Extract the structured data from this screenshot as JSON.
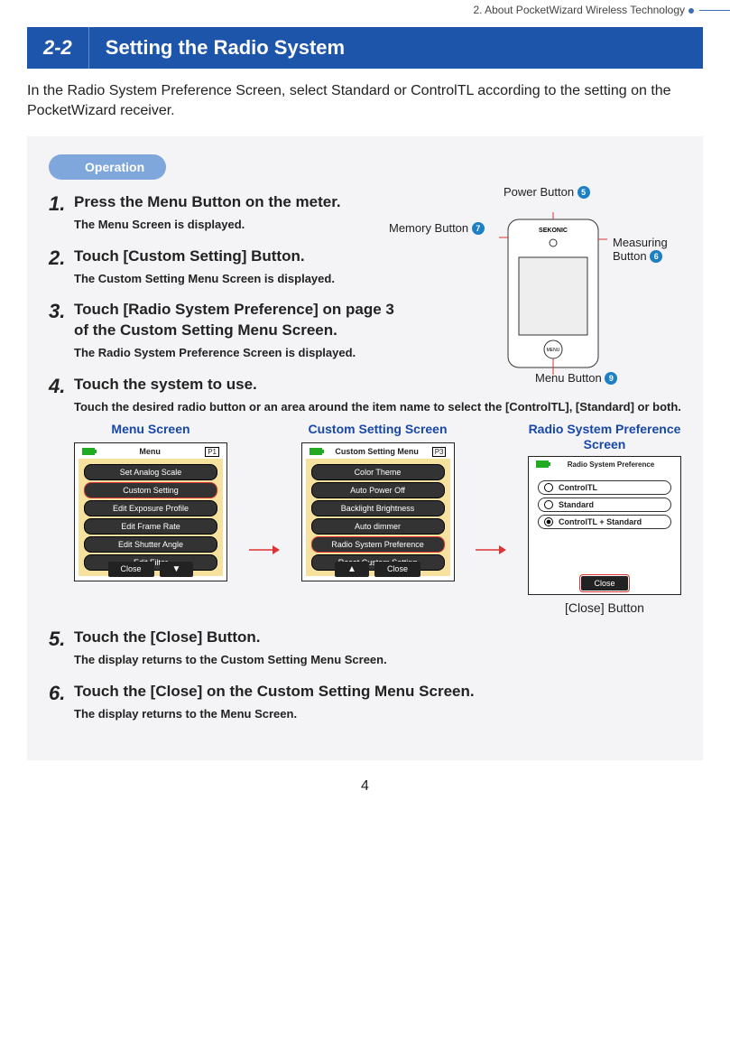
{
  "header_breadcrumb": "2.  About PocketWizard Wireless Technology",
  "section_number": "2-2",
  "section_title": "Setting the Radio System",
  "intro": "In the Radio System Preference Screen, select Standard or ControlTL according to the setting on the PocketWizard receiver.",
  "operation_label": "Operation",
  "diagram": {
    "power_button": "Power Button",
    "power_num": "5",
    "memory_button": "Memory Button",
    "memory_num": "7",
    "measuring_button_l1": "Measuring",
    "measuring_button_l2": "Button",
    "measuring_num": "6",
    "menu_button": "Menu Button",
    "menu_num": "9",
    "brand": "SEKONIC",
    "menu_text": "MENU"
  },
  "steps": [
    {
      "n": "1",
      "title": "Press the Menu Button on the meter.",
      "desc": "The Menu Screen is displayed."
    },
    {
      "n": "2",
      "title": "Touch [Custom Setting] Button.",
      "desc": "The Custom Setting Menu Screen is displayed."
    },
    {
      "n": "3",
      "title": "Touch [Radio System Preference] on page 3 of the Custom Setting Menu Screen.",
      "desc": "The Radio System Preference Screen is displayed."
    },
    {
      "n": "4",
      "title": "Touch the system to use.",
      "desc": "Touch the desired radio button or an area around the item name to select the [ControlTL], [Standard] or both."
    },
    {
      "n": "5",
      "title": "Touch the [Close] Button.",
      "desc": "The display returns to the Custom Setting Menu Screen."
    },
    {
      "n": "6",
      "title": "Touch the [Close] on the Custom Setting Menu Screen.",
      "desc": "The display returns to the Menu Screen."
    }
  ],
  "screens": {
    "s1": {
      "label": "Menu Screen",
      "title": "Menu",
      "page": "P1",
      "items": [
        "Set Analog Scale",
        "Custom Setting",
        "Edit Exposure Profile",
        "Edit Frame Rate",
        "Edit Shutter Angle",
        "Edit Filter"
      ],
      "selected_index": 1,
      "footer_close": "Close",
      "footer_down": "▼"
    },
    "s2": {
      "label": "Custom Setting Screen",
      "title": "Custom Setting Menu",
      "page": "P3",
      "items": [
        "Color Theme",
        "Auto Power Off",
        "Backlight Brightness",
        "Auto dimmer",
        "Radio System Preference",
        "Reset Custom Setting"
      ],
      "selected_index": 4,
      "footer_up": "▲",
      "footer_close": "Close"
    },
    "s3": {
      "label": "Radio System Preference Screen",
      "title": "Radio System Preference",
      "options": [
        "ControlTL",
        "Standard",
        "ControlTL + Standard"
      ],
      "selected_index": 2,
      "footer_close": "Close"
    },
    "close_caption": "[Close] Button"
  },
  "page_number": "4"
}
